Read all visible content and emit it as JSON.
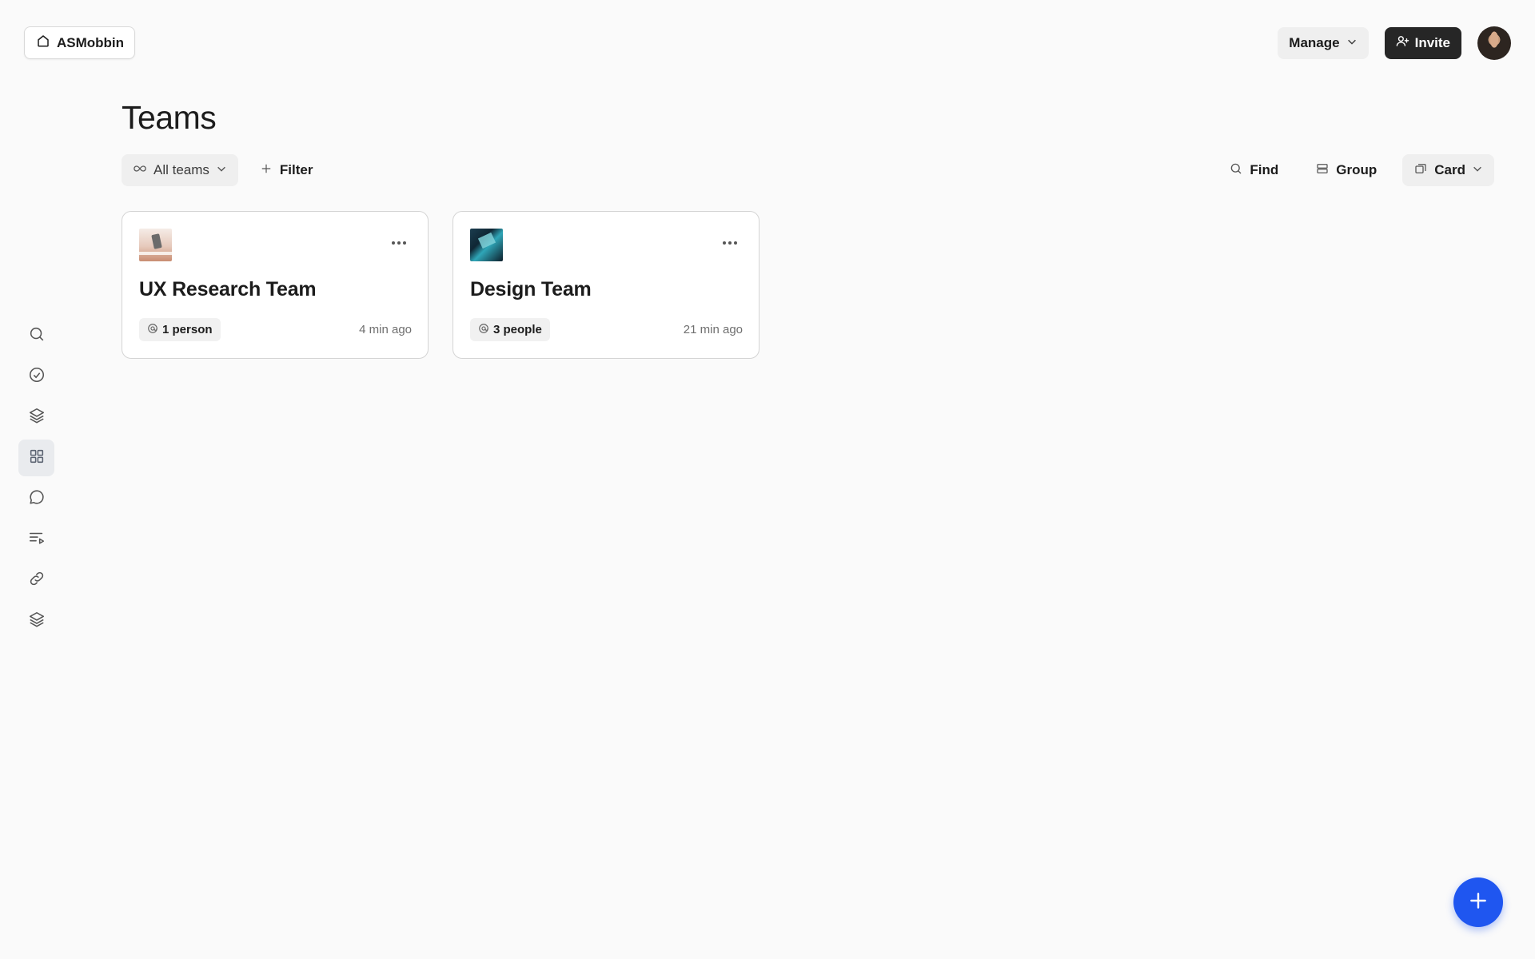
{
  "workspace": {
    "name": "ASMobbin",
    "icon": "home-icon"
  },
  "header": {
    "manage_label": "Manage",
    "invite_label": "Invite",
    "invite_icon": "user-plus-icon",
    "avatar_icon": "user-avatar"
  },
  "sidebar": {
    "items": [
      {
        "icon": "search-icon",
        "active": false
      },
      {
        "icon": "check-circle-icon",
        "active": false
      },
      {
        "icon": "layers-icon",
        "active": false
      },
      {
        "icon": "grid-icon",
        "active": true
      },
      {
        "icon": "chat-bubble-icon",
        "active": false
      },
      {
        "icon": "playlist-icon",
        "active": false
      },
      {
        "icon": "link-icon",
        "active": false
      },
      {
        "icon": "stack-icon",
        "active": false
      }
    ]
  },
  "page": {
    "title": "Teams"
  },
  "toolbar": {
    "scope_label": "All teams",
    "filter_label": "Filter",
    "find_label": "Find",
    "group_label": "Group",
    "view_label": "Card"
  },
  "teams": [
    {
      "name": "UX Research Team",
      "members": "1 person",
      "updated": "4 min ago",
      "thumb": "ux-research-thumbnail"
    },
    {
      "name": "Design Team",
      "members": "3 people",
      "updated": "21 min ago",
      "thumb": "design-thumbnail"
    }
  ],
  "fab": {
    "icon": "plus-icon"
  },
  "colors": {
    "accent": "#1f56f0",
    "invite_bg": "#262626",
    "active_nav": "#e9ebee"
  }
}
